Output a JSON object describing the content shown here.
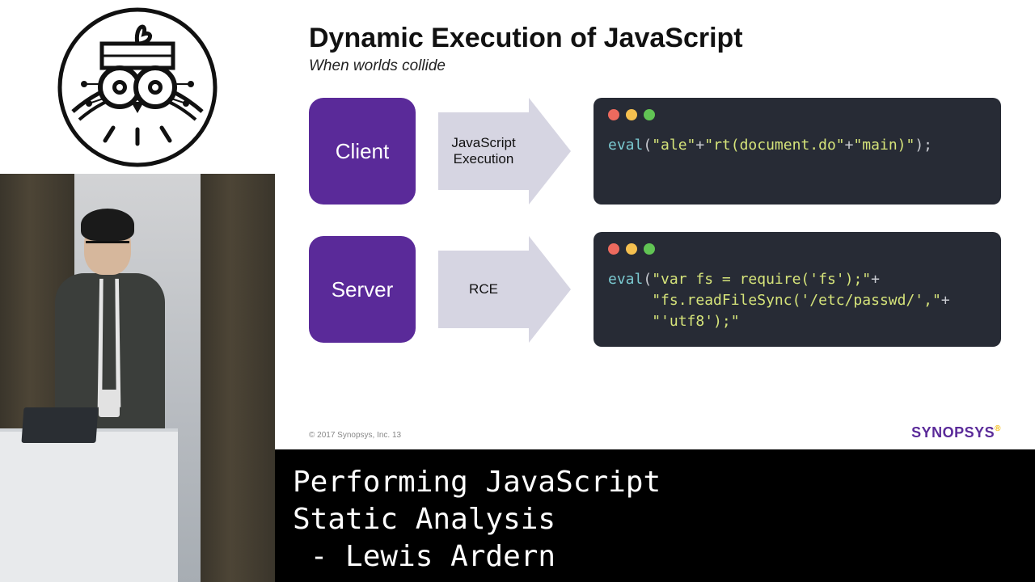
{
  "slide": {
    "title": "Dynamic Execution of JavaScript",
    "subtitle": "When worlds collide",
    "rows": [
      {
        "tag": "Client",
        "arrow_line1": "JavaScript",
        "arrow_line2": "Execution",
        "code_html": "<span class='fn'>eval</span><span class='pn'>(</span><span class='str'>\"ale\"</span><span class='pn'>+</span><span class='str'>\"rt(document.do\"</span><span class='pn'>+</span><span class='str'>\"main)\"</span><span class='pn'>);</span>"
      },
      {
        "tag": "Server",
        "arrow_line1": "RCE",
        "arrow_line2": "",
        "code_html": "<span class='fn'>eval</span><span class='pn'>(</span><span class='str'>\"var fs = require('fs');\"</span><span class='pn'>+</span>\n     <span class='str'>\"fs.readFileSync('/etc/passwd/',\"</span><span class='pn'>+</span>\n     <span class='str'>\"'utf8');\"</span>"
      }
    ],
    "footer": "© 2017 Synopsys, Inc.   13",
    "brand": "SYNOPSYS",
    "brand_mark": "®"
  },
  "caption": "Performing JavaScript\nStatic Analysis\n - Lewis Ardern"
}
